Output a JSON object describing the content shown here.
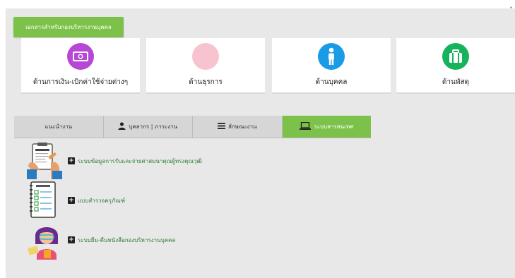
{
  "top_glyph": "ุ",
  "doc_button_label": "เอกสารสำหรับกองบริหารงานบุคคล",
  "cards": [
    {
      "label": "ด้านการเงิน-เบิกค่าใช้จ่ายต่างๆ",
      "icon": "money-icon",
      "color": "#b847d6"
    },
    {
      "label": "ด้านธุรการ",
      "icon": "blank-circle-icon",
      "color": "#f7c3cf"
    },
    {
      "label": "ด้านบุคคล",
      "icon": "person-icon",
      "color": "#1a9be6"
    },
    {
      "label": "ด้านพัสดุ",
      "icon": "package-icon",
      "color": "#17b35c"
    }
  ],
  "tabs": [
    {
      "label": "แนะนำงาน",
      "icon": ""
    },
    {
      "label": "บุคลากร | ภาระงาน",
      "icon": "user-icon"
    },
    {
      "label": "ลักษณะงาน",
      "icon": "list-icon"
    },
    {
      "label": "ระบบสารสนเทศ",
      "icon": "laptop-icon"
    }
  ],
  "active_tab": 3,
  "systems": [
    {
      "label": "ระบบข้อมูลการรับและจ่ายค่าสมนาคุณผู้ทรงคุณวุฒิ",
      "icon": "clipboard-hands-icon"
    },
    {
      "label": "แบบสำรวจครุภัณฑ์",
      "icon": "task-list-icon"
    },
    {
      "label": "ระบบยืม-คืนหนังสือกองบริหารงานบุคคล",
      "icon": "reader-icon"
    }
  ],
  "colors": {
    "accent": "#7cc24a",
    "link": "#2e7d32"
  }
}
